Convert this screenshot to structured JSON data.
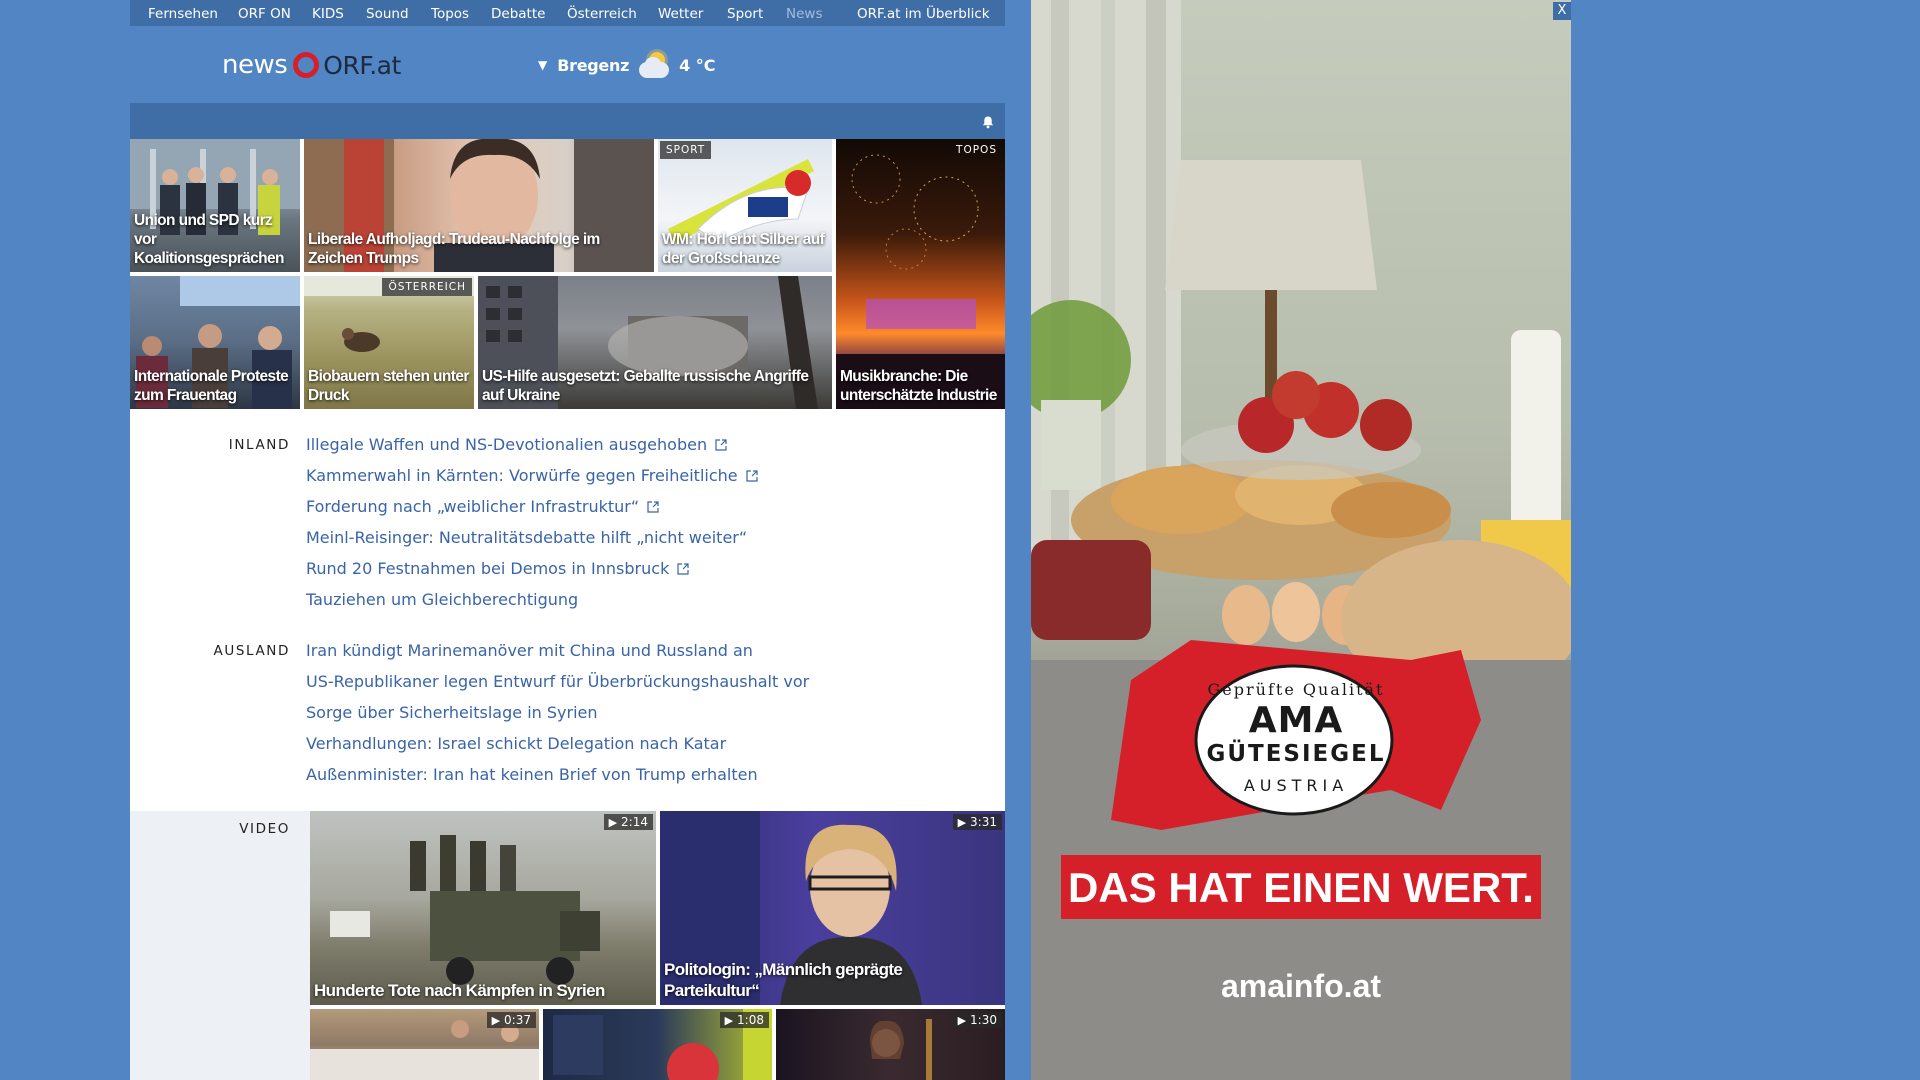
{
  "topnav": {
    "items": [
      "Fernsehen",
      "ORF ON",
      "KIDS",
      "Sound",
      "Topos",
      "Debatte",
      "Österreich",
      "Wetter",
      "Sport",
      "News"
    ],
    "overview": "ORF.at im Überblick"
  },
  "logo": {
    "news": "news",
    "orf": "ORF.at"
  },
  "weather": {
    "city": "Bregenz",
    "temp": "4 °C",
    "icon": "partly-cloudy-icon"
  },
  "tiles": [
    {
      "title": "Union und SPD kurz vor Koalitionsgesprächen",
      "tag": ""
    },
    {
      "title": "Liberale Aufholjagd: Trudeau-Nachfolge im Zeichen Trumps",
      "tag": ""
    },
    {
      "title": "WM: Hörl erbt Silber auf der Großschanze",
      "tag": "SPORT"
    },
    {
      "title": "",
      "tag": "TOPOS"
    },
    {
      "title": "Internationale Proteste zum Frauentag",
      "tag": ""
    },
    {
      "title": "Biobauern stehen unter Druck",
      "tag": "ÖSTERREICH"
    },
    {
      "title": "US-Hilfe ausgesetzt: Geballte russische Angriffe auf Ukraine",
      "tag": ""
    },
    {
      "title": "Musikbranche: Die unterschätzte Industrie",
      "tag": ""
    }
  ],
  "inland": {
    "label": "INLAND",
    "links": [
      "Illegale Waffen und NS-Devotionalien ausgehoben",
      "Kammerwahl in Kärnten: Vorwürfe gegen Freiheitliche",
      "Forderung nach „weiblicher Infrastruktur“",
      "Meinl-Reisinger: Neutralitätsdebatte hilft „nicht weiter“",
      "Rund 20 Festnahmen bei Demos in Innsbruck",
      "Tauziehen um Gleichberechtigung"
    ]
  },
  "ausland": {
    "label": "AUSLAND",
    "links": [
      "Iran kündigt Marinemanöver mit China und Russland an",
      "US-Republikaner legen Entwurf für Überbrückungshaushalt vor",
      "Sorge über Sicherheitslage in Syrien",
      "Verhandlungen: Israel schickt Delegation nach Katar",
      "Außenminister: Iran hat keinen Brief von Trump erhalten"
    ]
  },
  "video": {
    "label": "VIDEO",
    "items": [
      {
        "title": "Hunderte Tote nach Kämpfen in Syrien",
        "duration": "2:14"
      },
      {
        "title": "Politologin: „Männlich geprägte Parteikultur“",
        "duration": "3:31"
      },
      {
        "title": "",
        "duration": "0:37"
      },
      {
        "title": "",
        "duration": "1:08"
      },
      {
        "title": "",
        "duration": "1:30"
      }
    ]
  },
  "ad": {
    "seal_arc": "Geprüfte Qualität",
    "seal_ama": "AMA",
    "seal_guete": "GÜTESIEGEL",
    "seal_austria": "AUSTRIA",
    "slogan": "DAS HAT EINEN WERT.",
    "url": "amainfo.at",
    "close": "X"
  },
  "colors": {
    "page_bg": "#5285c4",
    "nav_bg": "#3f6ea6",
    "link": "#3a64a8",
    "brand_red": "#d5202a"
  }
}
